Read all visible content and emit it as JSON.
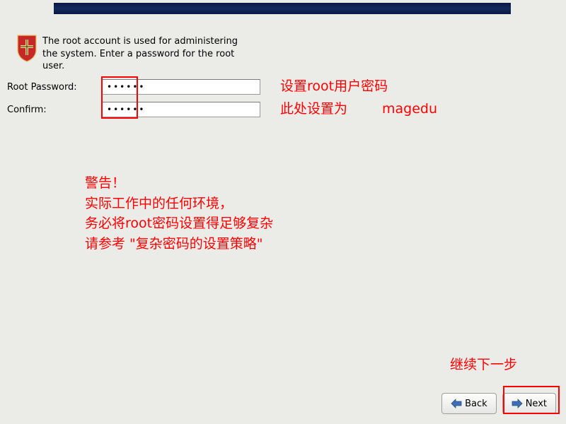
{
  "description": "The root account is used for administering the system.  Enter a password for the root user.",
  "form": {
    "password_label": "Root Password:",
    "confirm_label": "Confirm:",
    "password_value": "••••••",
    "confirm_value": "••••••"
  },
  "annotations": {
    "set_root_pw": "设置root用户密码",
    "here_set_as": "此处设置为",
    "example_pw": "magedu",
    "warning": "警告！\n实际工作中的任何环境，\n务必将root密码设置得足够复杂\n请参考 \"复杂密码的设置策略\"",
    "next_step": "继续下一步"
  },
  "buttons": {
    "back": "Back",
    "next": "Next"
  },
  "icons": {
    "shield": "shield-icon",
    "arrow_left": "arrow-left-icon",
    "arrow_right": "arrow-right-icon"
  }
}
